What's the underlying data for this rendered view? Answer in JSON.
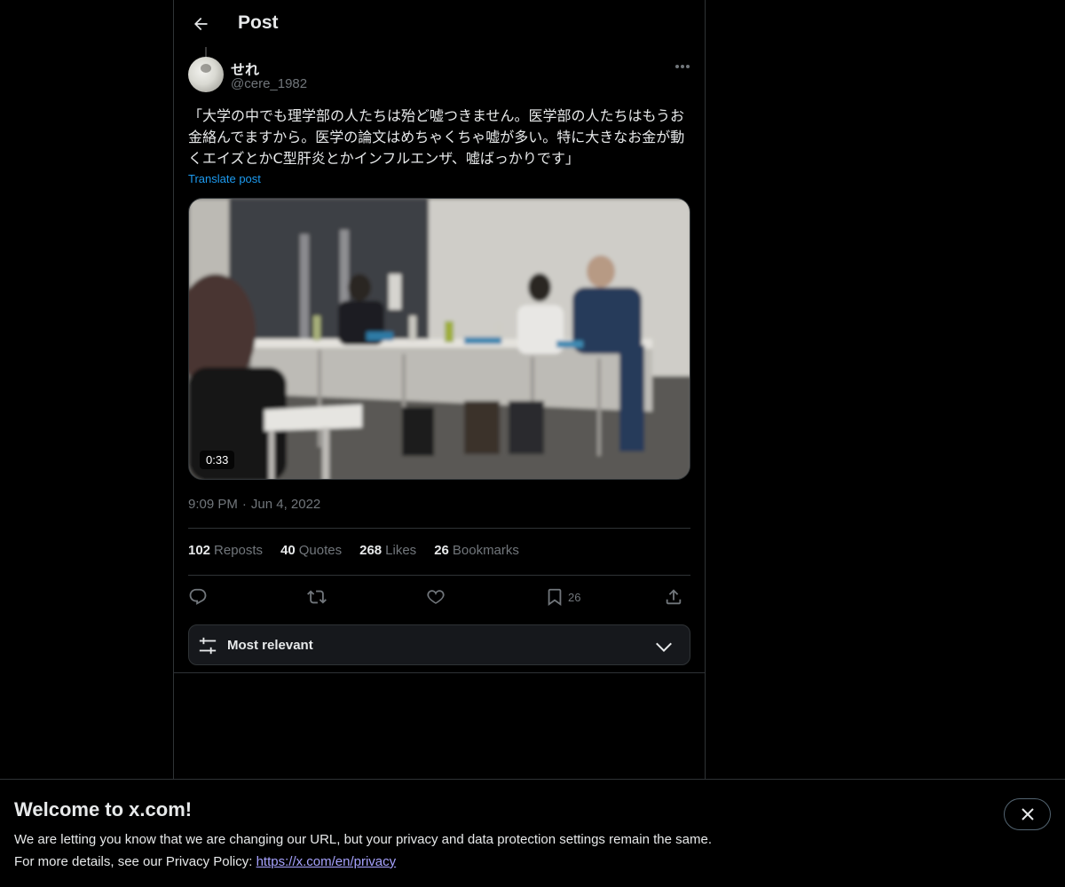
{
  "header": {
    "title": "Post",
    "back_icon": "arrow-left-icon"
  },
  "author": {
    "display_name": "せれ",
    "handle": "@cere_1982"
  },
  "post": {
    "text": "「大学の中でも理学部の人たちは殆ど嘘つきません。医学部の人たちはもうお金絡んでますから。医学の論文はめちゃくちゃ嘘が多い。特に大きなお金が動くエイズとかC型肝炎とかインフルエンザ、嘘ばっかりです」",
    "translate_label": "Translate post",
    "media": {
      "type": "video",
      "duration": "0:33"
    },
    "time": "9:09 PM",
    "separator": "·",
    "date": "Jun 4, 2022"
  },
  "stats": [
    {
      "count": "102",
      "label": "Reposts"
    },
    {
      "count": "40",
      "label": "Quotes"
    },
    {
      "count": "268",
      "label": "Likes"
    },
    {
      "count": "26",
      "label": "Bookmarks"
    }
  ],
  "actions": {
    "reply_icon": "reply-icon",
    "repost_icon": "repost-icon",
    "like_icon": "heart-icon",
    "bookmark_icon": "bookmark-icon",
    "bookmark_count": "26",
    "share_icon": "share-icon"
  },
  "sort": {
    "label": "Most relevant"
  },
  "notice": {
    "title": "Welcome to x.com!",
    "line1": "We are letting you know that we are changing our URL, but your privacy and data protection settings remain the same.",
    "line2_prefix": "For more details, see our Privacy Policy: ",
    "link_text": "https://x.com/en/privacy"
  },
  "colors": {
    "background": "#000000",
    "text": "#e7e9ea",
    "muted": "#71767b",
    "accent": "#1d9bf0",
    "border": "#2f3336"
  }
}
